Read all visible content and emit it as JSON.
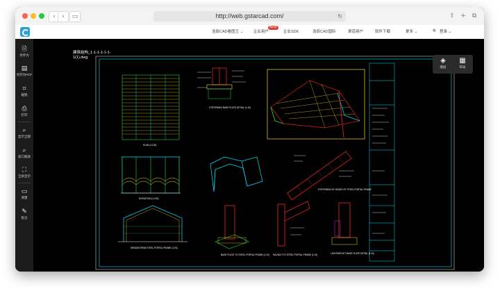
{
  "browser": {
    "url": "http://web.gstarcad.com/"
  },
  "appbar": {
    "menu": [
      {
        "label": "浩辰CAD看图王 ⌄"
      },
      {
        "label": "企业用户"
      },
      {
        "label": "企业SDK"
      },
      {
        "label": "浩辰CAD国际"
      },
      {
        "label": "渠道用户"
      },
      {
        "label": "软件下载"
      },
      {
        "label": "更多 ⌄"
      },
      {
        "label": "登录 ⌄"
      }
    ],
    "badge": "NEW"
  },
  "sidebar": {
    "items": [
      {
        "label": "另存为",
        "icon": "save-as-icon"
      },
      {
        "label": "另存为PDF",
        "icon": "pdf-icon"
      },
      {
        "label": "截图",
        "icon": "screenshot-icon"
      },
      {
        "label": "打印",
        "icon": "print-icon"
      },
      {
        "label": "显示全图",
        "icon": "zoom-extents-icon"
      },
      {
        "label": "窗口缩放",
        "icon": "zoom-window-icon"
      },
      {
        "label": "全屏显示",
        "icon": "fullscreen-icon"
      },
      {
        "label": "测量",
        "icon": "measure-icon"
      },
      {
        "label": "批注",
        "icon": "annotation-icon"
      }
    ]
  },
  "canvas": {
    "file_title_line1": "建筑结构_1-1-1-1-1-1-",
    "file_title_line2": "1(1).dwg"
  },
  "view_panel": {
    "layers_label": "图层",
    "layouts_label": "布局"
  },
  "drawing": {
    "labels": {
      "plan": "PLAN (1:100)",
      "elevation": "ELEVATION (1:100)",
      "base_plate": "STIFFENING BASE PLATE DETAIL (1:10)",
      "stiffening": "STIFFENING AT HEADS OF STEEL PORTAL FRAME",
      "medium_span": "MEDIUM SPAN STEEL PORTAL FRAME (1:20)",
      "base_to_frame": "BASE PLATE TO STEEL PORTAL FRAME (1:10)",
      "haunch": "HAUNCH TO STEEL PORTAL FRAME (1:10)",
      "lightweight_base": "LIGHTWEIGHT BASE PLATE DETAIL (1:10)"
    }
  },
  "colors": {
    "cad_cyan": "#00e5ff",
    "cad_yellow": "#f5e11a",
    "cad_red": "#e02020",
    "cad_green": "#20d640",
    "cad_magenta": "#ff40ff",
    "cad_white": "#ffffff",
    "logo_blue": "#2aa0d8"
  }
}
